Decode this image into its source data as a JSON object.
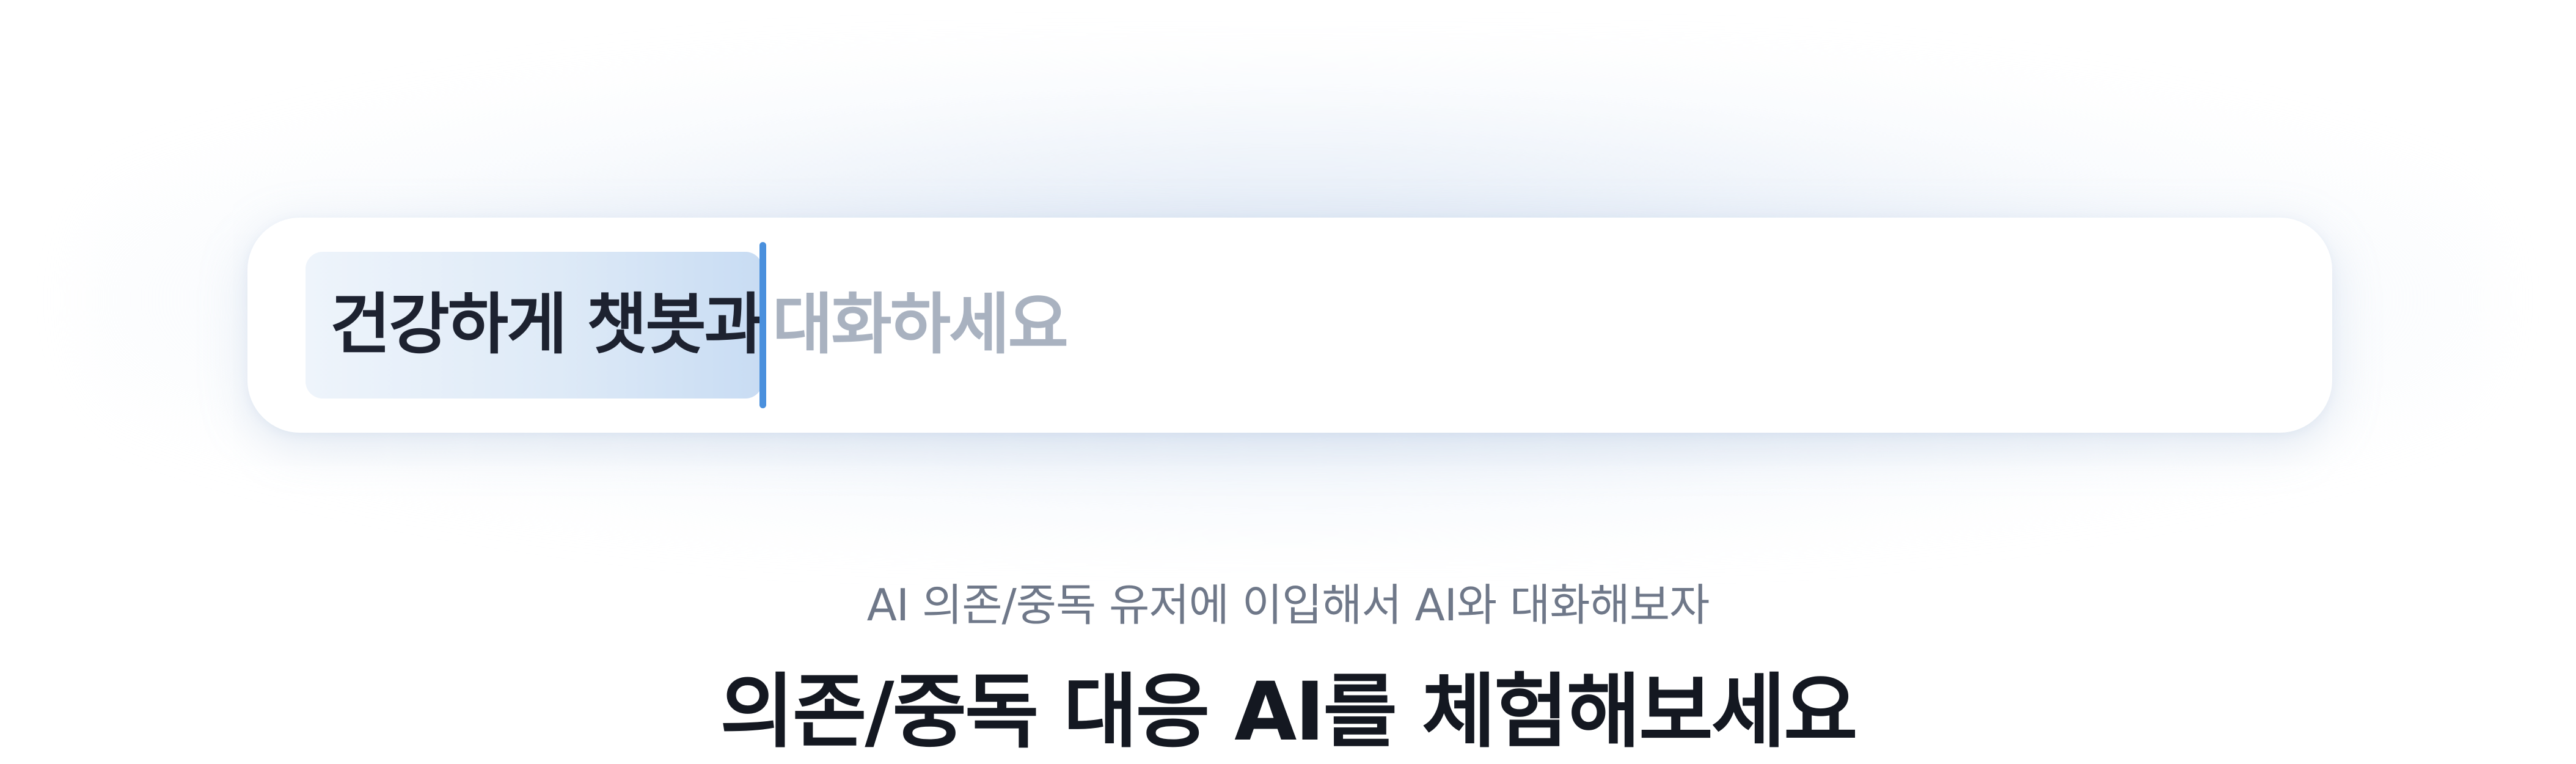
{
  "chat_input": {
    "typed_text": "건강하게 챗봇과",
    "placeholder_text": "대화하세요"
  },
  "hero": {
    "subtitle": "AI 의존/중독 유저에 이입해서 AI와 대화해보자",
    "headline": "의존/중독 대응 AI를 체험해보세요"
  },
  "colors": {
    "caret": "#4a90dd",
    "typed_text": "#1d2230",
    "placeholder": "#a9b2c0",
    "subtitle": "#6f7889",
    "headline": "#141821"
  }
}
